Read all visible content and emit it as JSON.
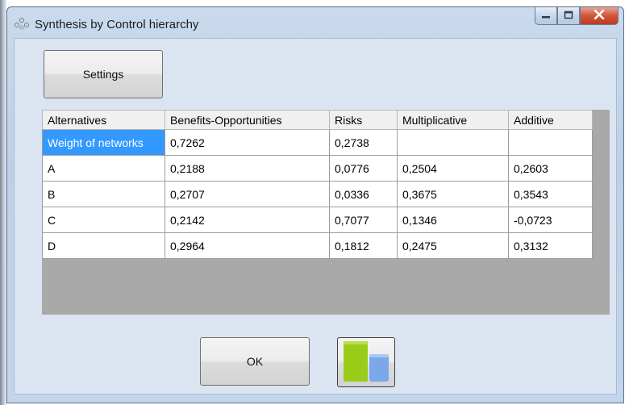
{
  "window": {
    "title": "Synthesis by Control hierarchy"
  },
  "toolbar": {
    "settings_label": "Settings"
  },
  "table": {
    "columns": [
      "Alternatives",
      "Benefits-Opportunities",
      "Risks",
      "Multiplicative",
      "Additive"
    ],
    "rows": [
      [
        "Weight of networks",
        "0,7262",
        "0,2738",
        "",
        ""
      ],
      [
        "A",
        "0,2188",
        "0,0776",
        "0,2504",
        "0,2603"
      ],
      [
        "B",
        "0,2707",
        "0,0336",
        "0,3675",
        "0,3543"
      ],
      [
        "C",
        "0,2142",
        "0,7077",
        "0,1346",
        "-0,0723"
      ],
      [
        "D",
        "0,2964",
        "0,1812",
        "0,2475",
        "0,3132"
      ]
    ]
  },
  "footer": {
    "ok_label": "OK",
    "chart_button_icon": "bar-chart-icon"
  },
  "colors": {
    "selection": "#3399ff",
    "chart_green": "#9acd1a",
    "chart_blue": "#7aa8e8",
    "close_button": "#c8452b"
  }
}
